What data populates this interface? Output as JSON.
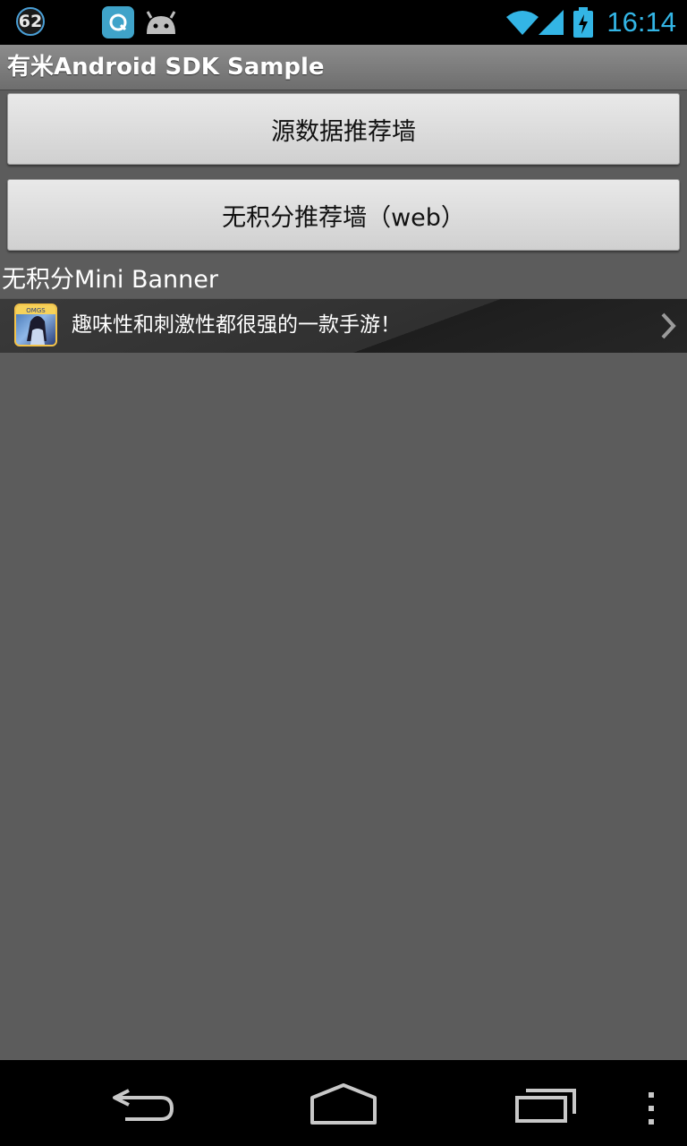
{
  "status_bar": {
    "notification_count": "62",
    "time": "16:14",
    "icons": [
      "notification-count-icon",
      "app-notification-icon",
      "android-icon",
      "wifi-icon",
      "signal-icon",
      "battery-charging-icon"
    ]
  },
  "app": {
    "title": "有米Android SDK Sample"
  },
  "buttons": {
    "source_wall": "源数据推荐墙",
    "web_wall": "无积分推荐墙（web）"
  },
  "banner": {
    "section_label": "无积分Mini Banner",
    "ad_text": "趣味性和刺激性都很强的一款手游！",
    "icon_badge": "OMGS"
  },
  "nav_bar": {
    "icons": [
      "back-icon",
      "home-icon",
      "recent-apps-icon",
      "menu-icon"
    ]
  },
  "colors": {
    "accent": "#33b5e5",
    "background": "#5c5c5c",
    "button": "#dcdcdc"
  }
}
